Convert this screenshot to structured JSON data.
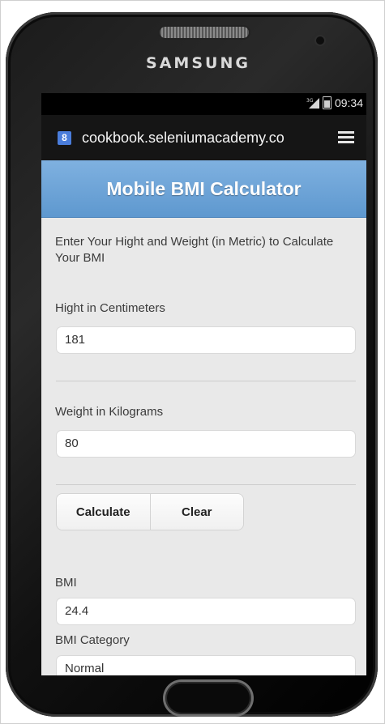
{
  "phone": {
    "brand": "SAMSUNG"
  },
  "statusbar": {
    "time": "09:34",
    "network": "3G"
  },
  "browser": {
    "favicon_letter": "8",
    "url": "cookbook.seleniumacademy.co",
    "menu_icon": "menu-icon"
  },
  "app": {
    "title": "Mobile BMI Calculator",
    "intro": "Enter Your Hight and Weight (in Metric) to Calculate Your BMI",
    "height_label": "Hight in Centimeters",
    "height_value": "181",
    "weight_label": "Weight in Kilograms",
    "weight_value": "80",
    "calculate_label": "Calculate",
    "clear_label": "Clear",
    "bmi_label": "BMI",
    "bmi_value": "24.4",
    "category_label": "BMI Category",
    "category_value": "Normal"
  },
  "colors": {
    "header_top": "#7fb1e0",
    "header_bottom": "#5e98cf",
    "content_bg": "#e9e9e9"
  }
}
